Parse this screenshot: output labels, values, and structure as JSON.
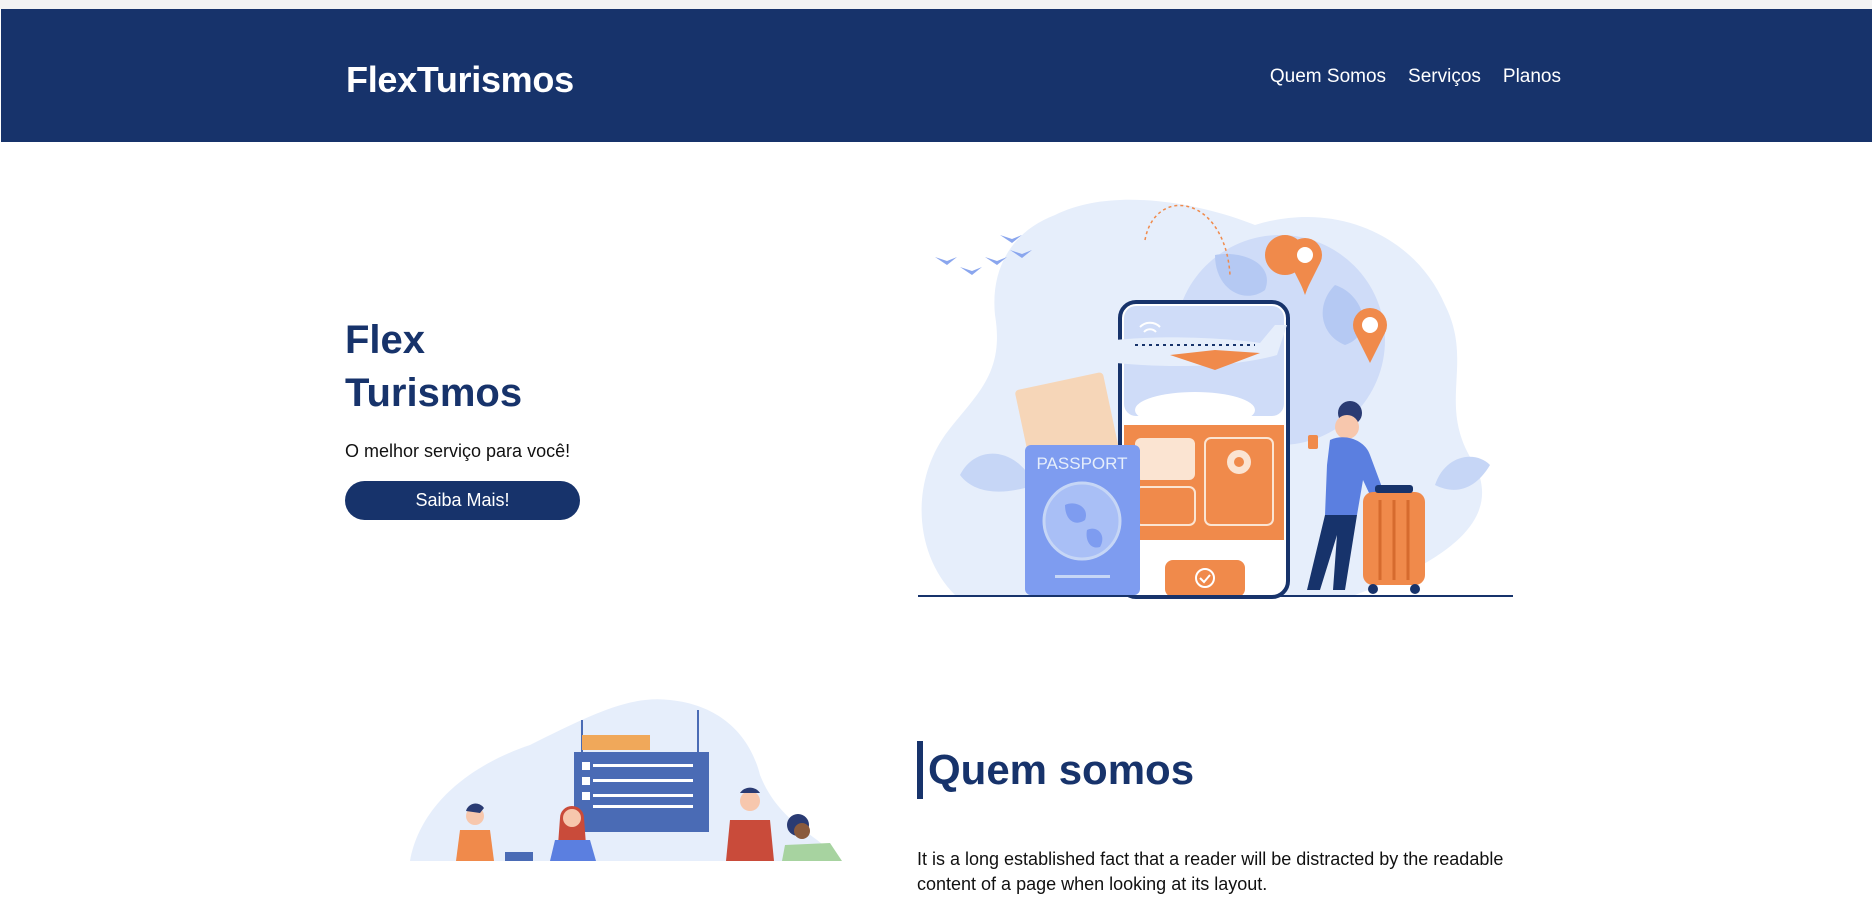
{
  "header": {
    "logo": "FlexTurismos",
    "nav": [
      "Quem Somos",
      "Serviços",
      "Planos"
    ]
  },
  "hero": {
    "title_line1": "Flex",
    "title_line2": "Turismos",
    "subtitle": "O melhor serviço para você!",
    "button": "Saiba Mais!",
    "illustration": {
      "passport_label": "PASSPORT",
      "icons": [
        "airplane-icon",
        "location-pin-icon",
        "wifi-icon",
        "check-icon",
        "suitcase-icon"
      ]
    }
  },
  "about": {
    "title": "Quem somos",
    "text": "It is a long established fact that a reader will be distracted by the readable content of a page when looking at its layout."
  },
  "colors": {
    "primary": "#17336b",
    "accent_orange": "#f08a4b",
    "light_blue": "#e6eefb",
    "mid_blue": "#7e9cf0"
  }
}
